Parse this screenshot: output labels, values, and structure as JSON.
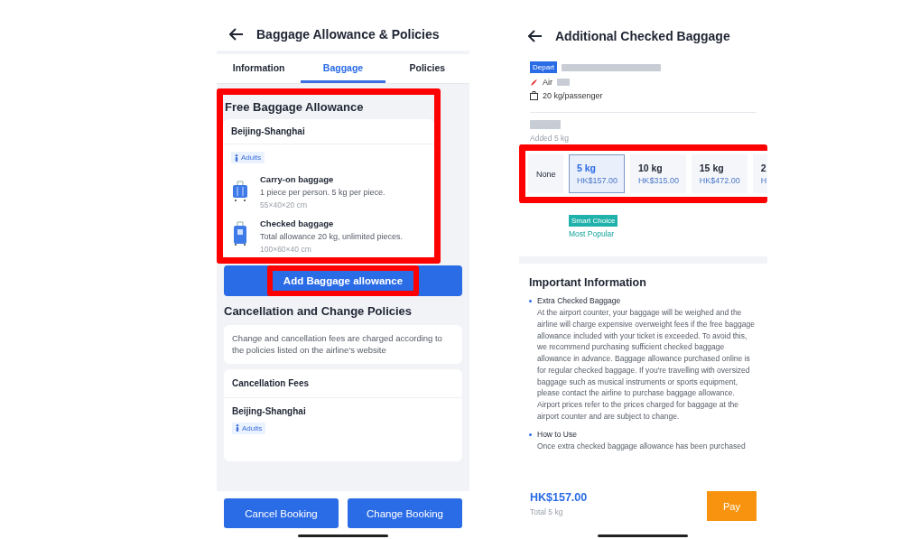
{
  "left_screen": {
    "title": "Baggage Allowance & Policies",
    "tabs": [
      {
        "label": "Information",
        "selected": false
      },
      {
        "label": "Baggage",
        "selected": true
      },
      {
        "label": "Policies",
        "selected": false
      }
    ],
    "allowance": {
      "heading": "Free Baggage Allowance",
      "highlighted": true,
      "route": "Beijing-Shanghai",
      "passenger": "Adults",
      "items": [
        {
          "kind": "carry_on",
          "title": "Carry-on baggage",
          "desc": "1 piece per person. 5 kg per piece.",
          "dims": "55×40×20 cm"
        },
        {
          "kind": "checked",
          "title": "Checked baggage",
          "desc": "Total allowance 20 kg, unlimited pieces.",
          "dims": "100×60×40 cm"
        }
      ]
    },
    "add_button": {
      "label": "Add Baggage allowance",
      "highlighted": true
    },
    "policies": {
      "heading": "Cancellation and Change Policies",
      "note": "Change and cancellation fees are charged according to the policies listed on the airline's website",
      "fees_title": "Cancellation Fees",
      "route": "Beijing-Shanghai",
      "passenger": "Adults"
    },
    "buttons": [
      "Cancel Booking",
      "Change Booking"
    ]
  },
  "right_screen": {
    "title": "Additional Checked Baggage",
    "flight": {
      "badge": "Depart",
      "airline": "Air",
      "allowance": "20 kg/passenger"
    },
    "added": "Added 5 kg",
    "options_highlighted": true,
    "options": [
      {
        "weight": "None",
        "selected": false
      },
      {
        "weight": "5 kg",
        "price": "HK$157.00",
        "selected": true
      },
      {
        "weight": "10 kg",
        "price": "HK$315.00",
        "selected": false
      },
      {
        "weight": "15 kg",
        "price": "HK$472.00",
        "selected": false
      },
      {
        "weight": "2",
        "price": "H",
        "selected": false
      }
    ],
    "tag": "Smart Choice",
    "tag_note": "Most Popular",
    "info": {
      "heading": "Important Information",
      "bullets": [
        {
          "title": "Extra Checked Baggage",
          "text": "At the airport counter, your baggage will be weighed and the airline will charge expensive overweight fees if the free baggage allowance included with your ticket is exceeded. To avoid this, we recommend purchasing sufficient checked baggage allowance in advance. Baggage allowance purchased online is for regular checked baggage. If you're travelling with oversized baggage such as musical instruments or sports equipment, please contact the airline to purchase baggage allowance. Airport prices refer to the prices charged for baggage at the airport counter and are subject to change."
        },
        {
          "title": "How to Use",
          "text": "Once extra checked baggage allowance has been purchased"
        }
      ]
    },
    "total_price": "HK$157.00",
    "total_note": "Total 5 kg",
    "pay": "Pay"
  }
}
